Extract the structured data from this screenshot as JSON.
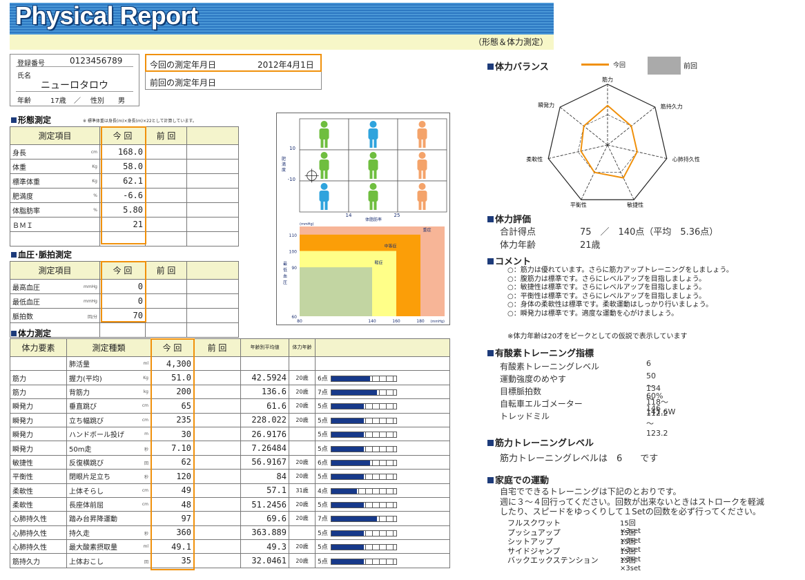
{
  "header": {
    "title": "Physical Report",
    "subtitle": "（形態＆体力測定）"
  },
  "profile": {
    "id_label": "登録番号",
    "id": "0123456789",
    "name_label": "氏名",
    "name": "ニューロタロウ",
    "age_label": "年齢",
    "age": "17歳",
    "slash": "／",
    "sex_label": "性別",
    "sex": "男"
  },
  "dates": {
    "current_label": "今回の測定年月日",
    "current_value": "2012年4月1日",
    "previous_label": "前回の測定年月日",
    "previous_value": ""
  },
  "body_section": {
    "title": "形態測定",
    "note": "※ 標準体重は身長(m)×身長(m)×22として計算しています。",
    "headers": [
      "測定項目",
      "今 回",
      "前 回"
    ],
    "rows": [
      {
        "item": "身長",
        "unit": "cm",
        "current": "168.0",
        "previous": ""
      },
      {
        "item": "体重",
        "unit": "Kg",
        "current": "58.0",
        "previous": ""
      },
      {
        "item": "標準体重",
        "unit": "Kg",
        "current": "62.1",
        "previous": ""
      },
      {
        "item": "肥満度",
        "unit": "%",
        "current": "-6.6",
        "previous": ""
      },
      {
        "item": "体脂肪率",
        "unit": "%",
        "current": "5.80",
        "previous": ""
      },
      {
        "item": "ＢＭＩ",
        "unit": "",
        "current": "21",
        "previous": ""
      }
    ]
  },
  "bp_section": {
    "title": "血圧･脈拍測定",
    "headers": [
      "測定項目",
      "今 回",
      "前 回"
    ],
    "rows": [
      {
        "item": "最高血圧",
        "unit": "mmHg",
        "current": "0",
        "previous": ""
      },
      {
        "item": "最低血圧",
        "unit": "mmHg",
        "current": "0",
        "previous": ""
      },
      {
        "item": "脈拍数",
        "unit": "回/分",
        "current": "70",
        "previous": ""
      }
    ]
  },
  "body_chart": {
    "ylabel": "肥満度",
    "xlabel": "体脂肪率",
    "y_ticks": [
      "10",
      "-10"
    ],
    "x_ticks": [
      "14",
      "25"
    ],
    "figures": [
      [
        "#6fbe3f",
        "#2ea3dd",
        "#f4a36a"
      ],
      [
        "#6fbe3f",
        "#6fbe3f",
        "#f4a36a"
      ],
      [
        "#2ea3dd",
        "#6fbe3f",
        "#f4a36a"
      ]
    ],
    "marker": {
      "body_fat": 5.8,
      "obesity": -6.6
    }
  },
  "bp_chart": {
    "unit": "(mmHg)",
    "ylabel": "最低血圧",
    "xlabel": "最高血圧",
    "y_ticks": [
      "110",
      "100",
      "90",
      "60"
    ],
    "x_ticks": [
      "80",
      "140",
      "160",
      "180"
    ],
    "xunit": "(mmHg)",
    "zones": [
      {
        "label": "重症",
        "color": "#f7b597"
      },
      {
        "label": "中等症",
        "color": "#fb9e08"
      },
      {
        "label": "軽症",
        "color": "#ffff88"
      },
      {
        "label": "",
        "color": "#c2d5a2"
      }
    ]
  },
  "fitness": {
    "title": "体力測定",
    "headers": [
      "体力要素",
      "測定種類",
      "今 回",
      "前 回",
      "年齢別平均値",
      "体力年齢"
    ],
    "rows": [
      {
        "element": "",
        "test": "肺活量",
        "unit": "ml",
        "current": "4,300",
        "previous": "",
        "average": "",
        "age": "",
        "score": "",
        "level": 0
      },
      {
        "element": "筋力",
        "test": "握力(平均)",
        "unit": "Kg",
        "current": "51.0",
        "previous": "",
        "average": "42.5924",
        "age": "20歳",
        "score": "6点",
        "level": 6
      },
      {
        "element": "筋力",
        "test": "背筋力",
        "unit": "kg",
        "current": "200",
        "previous": "",
        "average": "136.6",
        "age": "20歳",
        "score": "7点",
        "level": 7
      },
      {
        "element": "瞬発力",
        "test": "垂直跳び",
        "unit": "cm",
        "current": "65",
        "previous": "",
        "average": "61.6",
        "age": "20歳",
        "score": "5点",
        "level": 5
      },
      {
        "element": "瞬発力",
        "test": "立ち幅跳び",
        "unit": "cm",
        "current": "235",
        "previous": "",
        "average": "228.022",
        "age": "20歳",
        "score": "5点",
        "level": 5
      },
      {
        "element": "瞬発力",
        "test": "ハンドボール投げ",
        "unit": "m",
        "current": "30",
        "previous": "",
        "average": "26.9176",
        "age": "",
        "score": "5点",
        "level": 5
      },
      {
        "element": "瞬発力",
        "test": "50m走",
        "unit": "秒",
        "current": "7.10",
        "previous": "",
        "average": "7.26484",
        "age": "",
        "score": "5点",
        "level": 5
      },
      {
        "element": "敏捷性",
        "test": "反復横跳び",
        "unit": "回",
        "current": "62",
        "previous": "",
        "average": "56.9167",
        "age": "20歳",
        "score": "6点",
        "level": 6
      },
      {
        "element": "平衡性",
        "test": "閉眼片足立ち",
        "unit": "秒",
        "current": "120",
        "previous": "",
        "average": "84",
        "age": "20歳",
        "score": "5点",
        "level": 5
      },
      {
        "element": "柔軟性",
        "test": "上体そらし",
        "unit": "cm",
        "current": "49",
        "previous": "",
        "average": "57.1",
        "age": "31歳",
        "score": "4点",
        "level": 4
      },
      {
        "element": "柔軟性",
        "test": "長座体前屈",
        "unit": "cm",
        "current": "48",
        "previous": "",
        "average": "51.2456",
        "age": "20歳",
        "score": "5点",
        "level": 5
      },
      {
        "element": "心肺持久性",
        "test": "踏み台昇降運動",
        "unit": "",
        "current": "97",
        "previous": "",
        "average": "69.6",
        "age": "20歳",
        "score": "7点",
        "level": 7
      },
      {
        "element": "心肺持久性",
        "test": "持久走",
        "unit": "秒",
        "current": "360",
        "previous": "",
        "average": "363.889",
        "age": "",
        "score": "5点",
        "level": 5
      },
      {
        "element": "心肺持久性",
        "test": "最大酸素摂取量",
        "unit": "ml",
        "current": "49.1",
        "previous": "",
        "average": "49.3",
        "age": "20歳",
        "score": "5点",
        "level": 5
      },
      {
        "element": "筋持久力",
        "test": "上体おこし",
        "unit": "回",
        "current": "35",
        "previous": "",
        "average": "32.0461",
        "age": "20歳",
        "score": "5点",
        "level": 5
      }
    ]
  },
  "balance": {
    "title": "体力バランス",
    "legend_current": "今回",
    "legend_previous": "前回",
    "current_color": "#f0900a",
    "previous_color": "#aaaaaa",
    "axes": [
      "筋力",
      "筋持久力",
      "心肺持久性",
      "敏捷性",
      "平衡性",
      "柔軟性",
      "瞬発力"
    ],
    "values": [
      6.5,
      5,
      5,
      6,
      5,
      4.5,
      5
    ],
    "max": 10
  },
  "evaluation": {
    "title": "体力評価",
    "total_label": "合計得点",
    "total_value": "75　／　140点（平均　5.36点）",
    "age_label": "体力年齢",
    "age_value": "21歳"
  },
  "comment": {
    "title": "コメント",
    "lines": [
      "○：筋力は優れています。さらに筋力アップトレーニングをしましょう。",
      "○：腹筋力は標準です。さらにレベルアップを目指しましょう。",
      "○：敏捷性は標準です。さらにレベルアップを目指しましょう。",
      "○：平衡性は標準です。さらにレベルアップを目指しましょう。",
      "○：身体の柔軟性は標準です。柔軟運動はしっかり行いましょう。",
      "○：瞬発力は標準です。適度な運動を心がけましょう。"
    ],
    "note": "※体力年齢は20才をピークとしての仮説で表示しています"
  },
  "aerobic": {
    "title": "有酸素トレーニング指標",
    "rows": [
      {
        "label": "有酸素トレーニングレベル",
        "value": "6"
      },
      {
        "label": "運動強度のめやす",
        "value": "50～60%"
      },
      {
        "label": "目標脈拍数",
        "value": "134～146"
      },
      {
        "label": "自転車エルゴメーター",
        "value": "118～141.6W"
      },
      {
        "label": "トレッドミル",
        "value": "112.2～123.2"
      }
    ]
  },
  "strength": {
    "title": "筋力トレーニングレベル",
    "text": "筋力トレーニングレベルは　6　　です"
  },
  "home": {
    "title": "家庭での運動",
    "intro1": "自宅でできるトレーニングは下記のとおりです。",
    "intro2": "週に３～４回行ってください。回数が出来ないときはストロークを軽減",
    "intro3": "したり、スピードをゆっくりして１Setの回数を必ず行ってください。",
    "items": [
      {
        "name": "フルスクワット",
        "sets": "15回×3set"
      },
      {
        "name": "プッシュアップ",
        "sets": "15回×3set"
      },
      {
        "name": "シットアップ",
        "sets": "15回×3set"
      },
      {
        "name": "サイドジャンプ",
        "sets": "15回×3set"
      },
      {
        "name": "バックエックステンション",
        "sets": "15回×3set"
      }
    ]
  }
}
